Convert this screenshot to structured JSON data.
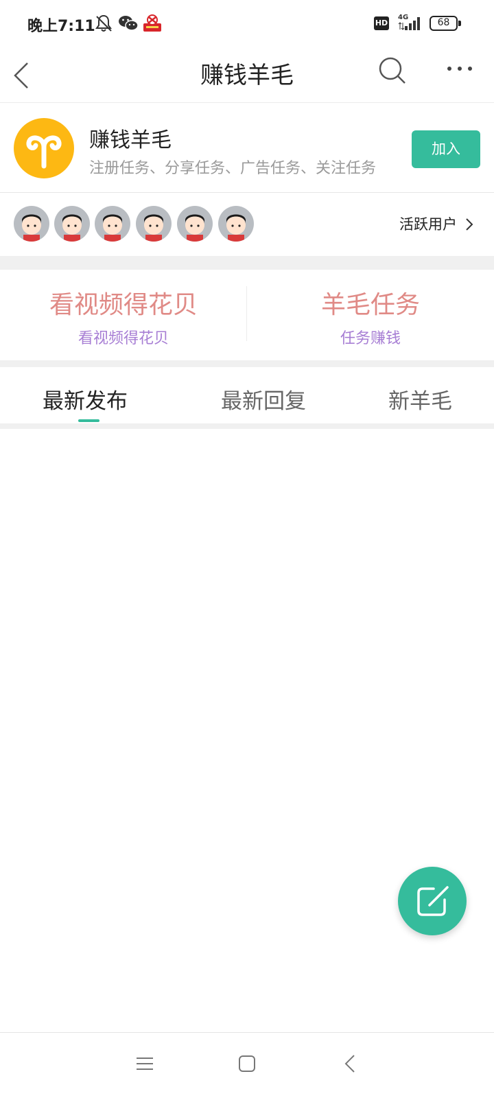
{
  "status_bar": {
    "time": "晚上7:11",
    "icons": [
      "mute-bell-icon",
      "wechat-icon",
      "app-notification-icon",
      "hd-icon",
      "4g-signal-icon"
    ],
    "hd_label": "HD",
    "network_label": "4G",
    "battery": "68"
  },
  "navbar": {
    "title": "赚钱羊毛",
    "back_icon": "chevron-left-icon",
    "search_icon": "search-icon",
    "more_icon": "more-horizontal-icon"
  },
  "group": {
    "logo_icon": "aries-icon",
    "name": "赚钱羊毛",
    "description": "注册任务、分享任务、广告任务、关注任务",
    "join_label": "加入"
  },
  "active_users": {
    "avatar_count": 6,
    "link_label": "活跃用户"
  },
  "features": [
    {
      "title": "看视频得花贝",
      "subtitle": "看视频得花贝"
    },
    {
      "title": "羊毛任务",
      "subtitle": "任务赚钱"
    }
  ],
  "tabs": [
    {
      "label": "最新发布",
      "active": true
    },
    {
      "label": "最新回复",
      "active": false
    },
    {
      "label": "新羊毛",
      "active": false
    }
  ],
  "fab": {
    "icon": "compose-icon"
  },
  "system_nav": {
    "icons": [
      "menu-icon",
      "home-square-icon",
      "back-icon"
    ]
  },
  "colors": {
    "accent": "#35bc9c",
    "logo_bg": "#fdb813",
    "feature_title": "#e08a86",
    "feature_subtitle": "#a77ed4"
  }
}
